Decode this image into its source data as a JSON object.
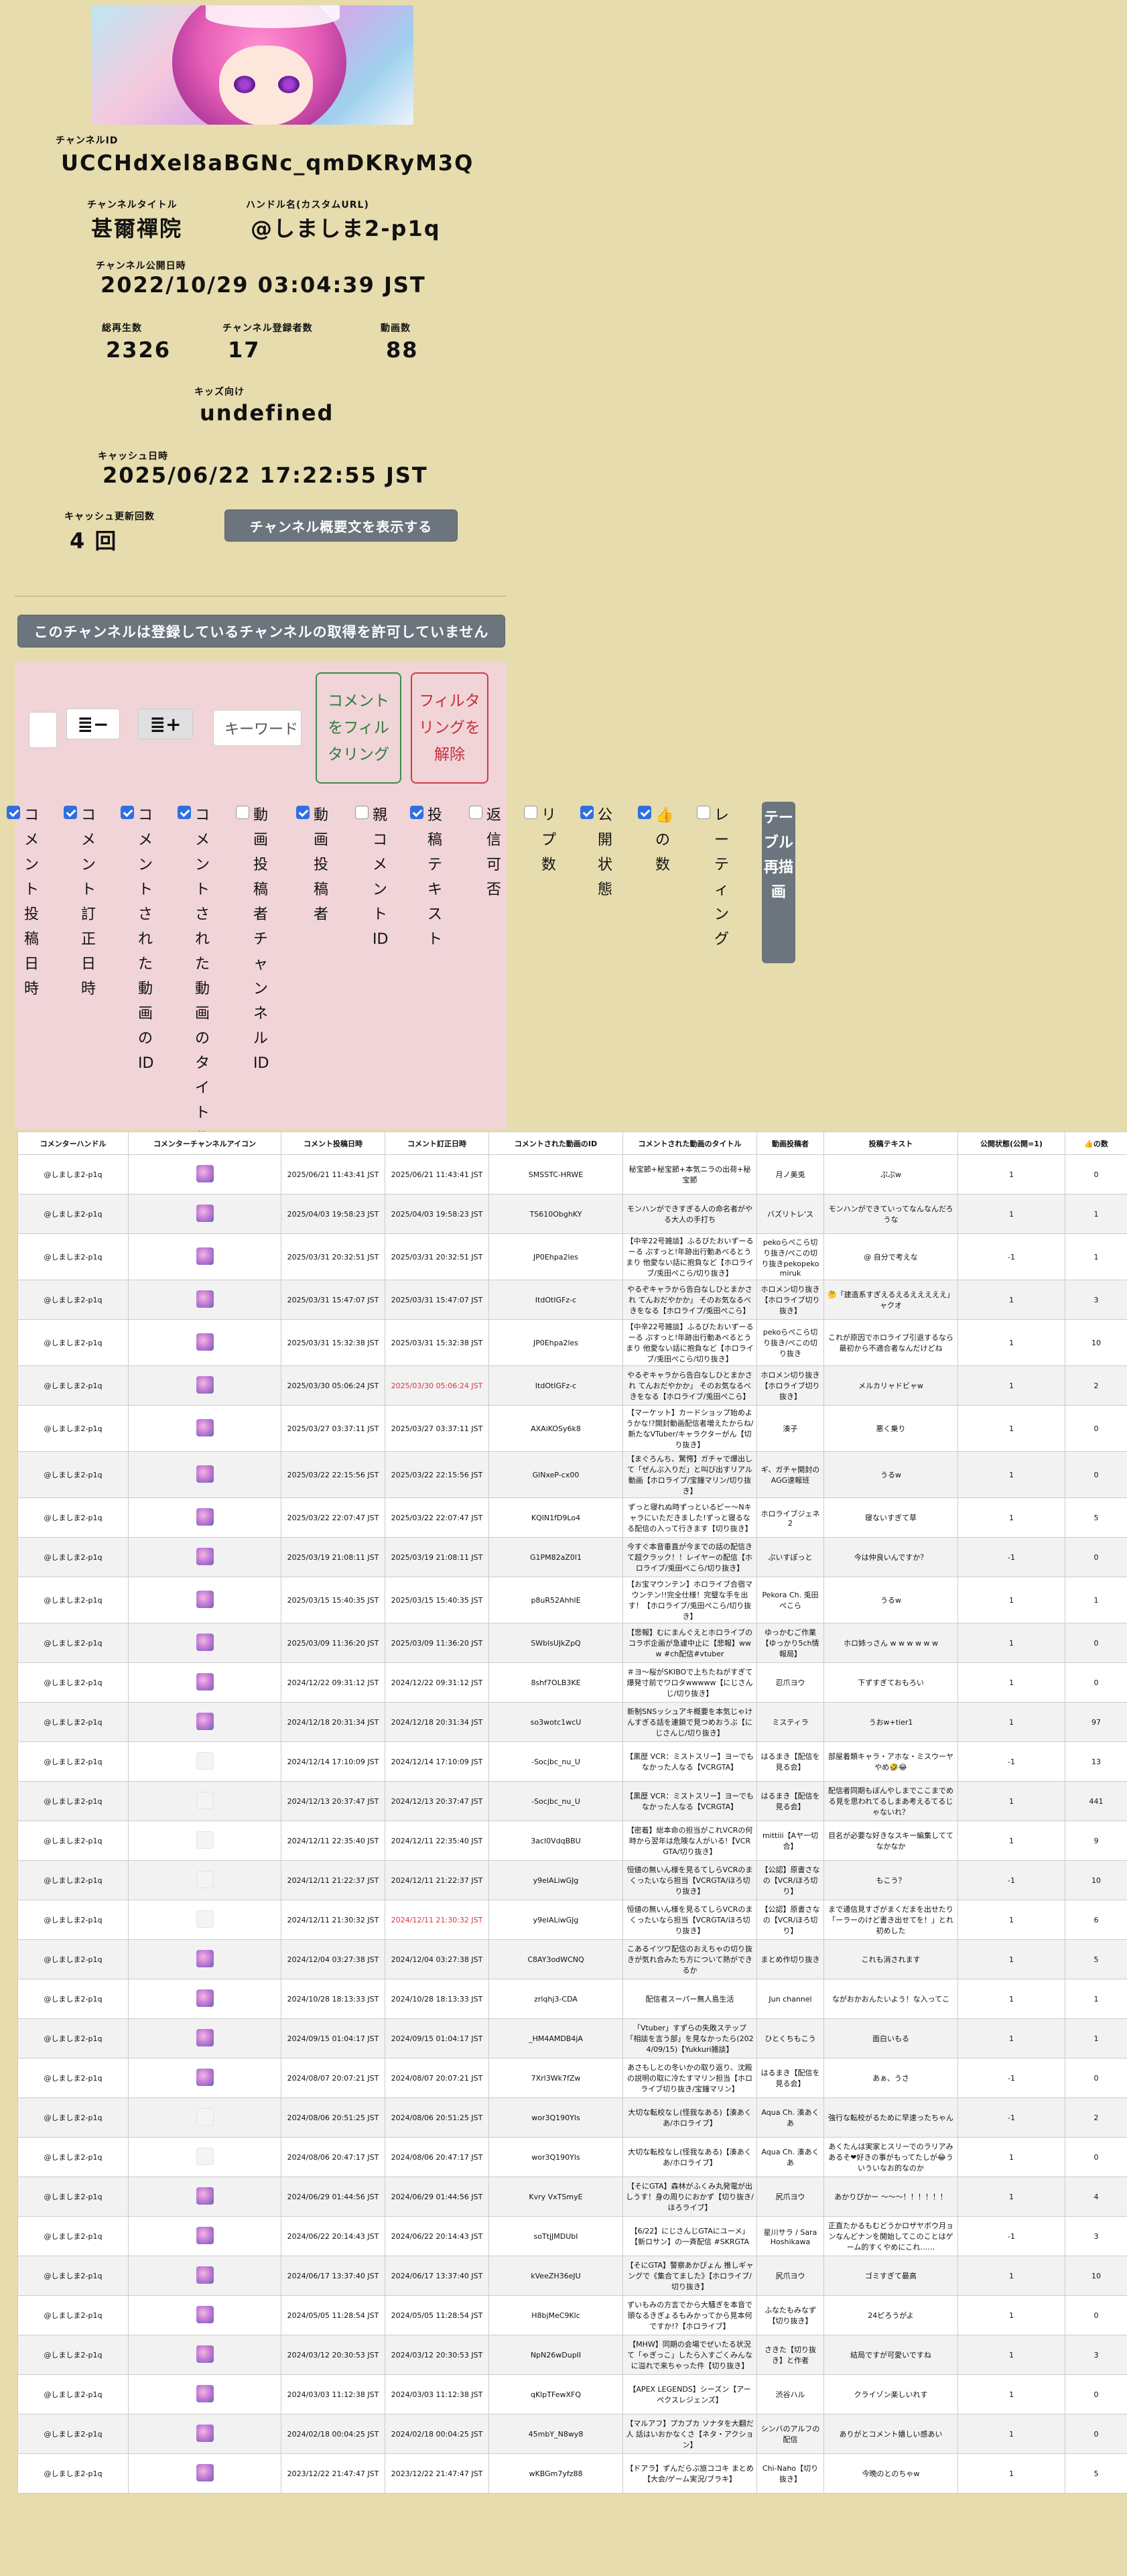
{
  "channel": {
    "id_label": "チャンネルID",
    "id": "UCCHdXel8aBGNc_qmDKRyM3Q",
    "title_label": "チャンネルタイトル",
    "title": "甚爾禪院",
    "handle_label": "ハンドル名(カスタムURL)",
    "handle": "@しましま2-p1q",
    "published_label": "チャンネル公開日時",
    "published": "2022/10/29 03:04:39 JST",
    "views_label": "総再生数",
    "views": "2326",
    "subs_label": "チャンネル登録者数",
    "subs": "17",
    "videos_label": "動画数",
    "videos": "88",
    "kids_label": "キッズ向け",
    "kids": "undefined",
    "cache_label": "キャッシュ日時",
    "cache": "2025/06/22 17:22:55 JST",
    "cache_count_label": "キャッシュ更新回数",
    "cache_count": "4 回",
    "show_desc_button": "チャンネル概要文を表示する"
  },
  "subscriptions_notice": "このチャンネルは登録しているチャンネルの取得を許可していません",
  "toolbar": {
    "keyword_placeholder": "キーワード",
    "filter_button": "コメントをフィルタリング",
    "clear_button": "フィルタリングを解除",
    "icon_minus": "≣−",
    "icon_plus": "≣+"
  },
  "column_options": [
    {
      "label": "コメント投稿日時",
      "checked": true
    },
    {
      "label": "コメント訂正日時",
      "checked": true
    },
    {
      "label": "コメントされた動画のID",
      "checked": true
    },
    {
      "label": "コメントされた動画のタイトル",
      "checked": true
    },
    {
      "label": "動画投稿者チャンネルID",
      "checked": false
    },
    {
      "label": "動画投稿者",
      "checked": true
    },
    {
      "label": "親コメントID",
      "checked": false
    },
    {
      "label": "投稿テキスト",
      "checked": true
    },
    {
      "label": "返信可否",
      "checked": false
    },
    {
      "label": "リプ数",
      "checked": false
    },
    {
      "label": "公開状態",
      "checked": true
    },
    {
      "label": "👍の数",
      "checked": true
    },
    {
      "label": "レーティング",
      "checked": false
    }
  ],
  "redraw_button": "テーブル再描画",
  "table": {
    "headers": [
      "コメンターハンドル",
      "コメンターチャンネルアイコン",
      "コメント投稿日時",
      "コメント訂正日時",
      "コメントされた動画のID",
      "コメントされた動画のタイトル",
      "動画投稿者",
      "投稿テキスト",
      "公開状態(公開=1)",
      "👍の数"
    ],
    "rows": [
      {
        "handle": "@しましま2-p1q",
        "icon": true,
        "posted": "2025/06/21 11:43:41 JST",
        "edited": "2025/06/21 11:43:41 JST",
        "vid": "SMSSTC-HRWE",
        "title": "秘宝節+秘宝節+本気ニラの出荷+秘宝節",
        "owner": "月ノ美兎",
        "text": "ぷぷw",
        "public": "1",
        "likes": "0",
        "red": false
      },
      {
        "handle": "@しましま2-p1q",
        "icon": true,
        "posted": "2025/04/03 19:58:23 JST",
        "edited": "2025/04/03 19:58:23 JST",
        "vid": "TS610ObghKY",
        "title": "モンハンができすぎる人の命名者がやる大人の手打ち",
        "owner": "バズリトレ'ス",
        "text": "モンハンができていってなんなんだろうな",
        "public": "1",
        "likes": "1",
        "red": false
      },
      {
        "handle": "@しましま2-p1q",
        "icon": true,
        "posted": "2025/03/31 20:32:51 JST",
        "edited": "2025/03/31 20:32:51 JST",
        "vid": "JP0Ehpa2les",
        "title": "【中辛22号雑談】ふるびたおいずーるーる ぷすっと!年跡出行動あべるとうまり 他愛ない話に抱負など【ホロライブ/兎田ぺこら/切り抜き】",
        "owner": "pekoらぺこら切り抜き/ぺこの切り抜きpekopekomiruk",
        "text": "@ 自分で考えな",
        "public": "-1",
        "likes": "1",
        "red": false
      },
      {
        "handle": "@しましま2-p1q",
        "icon": true,
        "posted": "2025/03/31 15:47:07 JST",
        "edited": "2025/03/31 15:47:07 JST",
        "vid": "ItdOtIGFz-c",
        "title": "やるぞキャラから告白なしひとまかされ てんおだやかか」 そのお気なるべきをなる【ホロライブ/兎田ぺこら】",
        "owner": "ホロメン切り抜き【ホロライブ切り抜き】",
        "text": "🤔「建造系すぎえるえるえええええ」ャクオ",
        "public": "1",
        "likes": "3",
        "red": false
      },
      {
        "handle": "@しましま2-p1q",
        "icon": true,
        "posted": "2025/03/31 15:32:38 JST",
        "edited": "2025/03/31 15:32:38 JST",
        "vid": "JP0Ehpa2les",
        "title": "【中辛22号雑談】ふるびたおいずーるーる ぷすっと!年跡出行動あべるとうまり 他愛ない話に抱負など【ホロライブ/兎田ぺこら/切り抜き】",
        "owner": "pekoらぺこら切り抜き/ぺこの切り抜き",
        "text": "これが原因でホロライブ引退するなら最初から不適合者なんだけどね",
        "public": "1",
        "likes": "10",
        "red": false
      },
      {
        "handle": "@しましま2-p1q",
        "icon": true,
        "posted": "2025/03/30 05:06:24 JST",
        "edited": "2025/03/30 05:06:24 JST",
        "vid": "ItdOtIGFz-c",
        "title": "やるぞキャラから告白なしひとまかされ てんおだやかか」 そのお気なるべきをなる【ホロライブ/兎田ぺこら】",
        "owner": "ホロメン切り抜き【ホロライブ切り抜き】",
        "text": "メルカリャドビャw",
        "public": "1",
        "likes": "2",
        "red": true
      },
      {
        "handle": "@しましま2-p1q",
        "icon": true,
        "posted": "2025/03/27 03:37:11 JST",
        "edited": "2025/03/27 03:37:11 JST",
        "vid": "AXAiKOSy6k8",
        "title": "【マーケット】カードショップ始めようかな!?開封動画配信者増えたからね/新たなVTuber/キャラクターがん【切り抜き】",
        "owner": "湊子",
        "text": "悪く乗り",
        "public": "1",
        "likes": "0",
        "red": false
      },
      {
        "handle": "@しましま2-p1q",
        "icon": true,
        "posted": "2025/03/22 22:15:56 JST",
        "edited": "2025/03/22 22:15:56 JST",
        "vid": "GlNxeP-cx00",
        "title": "【まぐろんち、驚愕】ガチャで爆出して「ぜんぶ入りだ」と叫び出すリアル動画【ホロライブ/宝鐘マリン/切り抜き】",
        "owner": "ギ、ガチャ開封のAGG速報班",
        "text": "うるw",
        "public": "1",
        "likes": "0",
        "red": false
      },
      {
        "handle": "@しましま2-p1q",
        "icon": true,
        "posted": "2025/03/22 22:07:47 JST",
        "edited": "2025/03/22 22:07:47 JST",
        "vid": "KQlN1fD9Lo4",
        "title": "ずっと寝れぬ時ずっといるピー～Nキャラにいただきました!ずっと寝るなる配信の入って行きます【切り抜き】",
        "owner": "ホロライブジェネ2",
        "text": "寝ないすぎて草",
        "public": "1",
        "likes": "5",
        "red": false
      },
      {
        "handle": "@しましま2-p1q",
        "icon": true,
        "posted": "2025/03/19 21:08:11 JST",
        "edited": "2025/03/19 21:08:11 JST",
        "vid": "G1PM82aZ0l1",
        "title": "今すぐ本音垂直が今までの話の配信きて超クラック！！レイヤーの配信【ホロライブ/兎田ぺこら/切り抜き】",
        "owner": "ぷいすぽっと",
        "text": "今は仲良いんですか？",
        "public": "-1",
        "likes": "0",
        "red": false
      },
      {
        "handle": "@しましま2-p1q",
        "icon": true,
        "posted": "2025/03/15 15:40:35 JST",
        "edited": "2025/03/15 15:40:35 JST",
        "vid": "p8uR52AhhlE",
        "title": "【お宝マウンテン】ホロライブ合宿マウンテン!!完全仕様！完璧な手を出す！【ホロライブ/兎田ぺこら/切り抜き】",
        "owner": "Pekora Ch. 兎田ぺこら",
        "text": "うるw",
        "public": "1",
        "likes": "1",
        "red": false
      },
      {
        "handle": "@しましま2-p1q",
        "icon": true,
        "posted": "2025/03/09 11:36:20 JST",
        "edited": "2025/03/09 11:36:20 JST",
        "vid": "SWblsUJkZpQ",
        "title": "【悲報】むにまんぐえとホロライブのコラボ企画が急遽中止に【悲報】www #ch配信#vtuber",
        "owner": "ゆっかむご作業【ゆっかり5ch情報局】",
        "text": "ホロ姉っさん w w w w w w",
        "public": "1",
        "likes": "0",
        "red": false
      },
      {
        "handle": "@しましま2-p1q",
        "icon": true,
        "posted": "2024/12/22 09:31:12 JST",
        "edited": "2024/12/22 09:31:12 JST",
        "vid": "8shf7OLB3KE",
        "title": "＃ヨ～桜がSKIBOで上ちたねがすぎて爆発寸前でワロタwwwww【にじさんじ/切り抜き】",
        "owner": "忍爪ヨウ",
        "text": "下ずすぎておもろい",
        "public": "1",
        "likes": "0",
        "red": false
      },
      {
        "handle": "@しましま2-p1q",
        "icon": true,
        "posted": "2024/12/18 20:31:34 JST",
        "edited": "2024/12/18 20:31:34 JST",
        "vid": "so3wotc1wcU",
        "title": "新制SNSッシュアキ概要を本気じゃけんすぎる話を連鎖で見つめおうぶ【にじさんじ/切り抜き】",
        "owner": "ミスティラ",
        "text": "うおw+tier1",
        "public": "1",
        "likes": "97",
        "red": false
      },
      {
        "handle": "@しましま2-p1q",
        "icon": false,
        "posted": "2024/12/14 17:10:09 JST",
        "edited": "2024/12/14 17:10:09 JST",
        "vid": "-Socjbc_nu_U",
        "title": "【黒歴 VCR：ミストスリー】ヨーでもなかった人なる【VCRGTA】",
        "owner": "はるまき【配信を見る会】",
        "text": "部屋着類キャラ・アホな・ミスウーヤやめ🤣😂",
        "public": "-1",
        "likes": "13",
        "red": false
      },
      {
        "handle": "@しましま2-p1q",
        "icon": false,
        "posted": "2024/12/13 20:37:47 JST",
        "edited": "2024/12/13 20:37:47 JST",
        "vid": "-Socjbc_nu_U",
        "title": "【黒歴 VCR：ミストスリー】ヨーでもなかった人なる【VCRGTA】",
        "owner": "はるまき【配信を見る会】",
        "text": "配信者同期もぼんやしまでここまでめる見を思われてるしまあ考えるてるじゃないれ？",
        "public": "1",
        "likes": "441",
        "red": false
      },
      {
        "handle": "@しましま2-p1q",
        "icon": false,
        "posted": "2024/12/11 22:35:40 JST",
        "edited": "2024/12/11 22:35:40 JST",
        "vid": "3acl0VdqBBU",
        "title": "【密着】総本命の担当がこれVCRの何時から翌年は危険な人がいる!【VCR GTA/切り抜き】",
        "owner": "mittiii【Aヤ一切合】",
        "text": "目名が必要な好きなスキー編集しててなかなか",
        "public": "1",
        "likes": "9",
        "red": false
      },
      {
        "handle": "@しましま2-p1q",
        "icon": false,
        "posted": "2024/12/11 21:22:37 JST",
        "edited": "2024/12/11 21:22:37 JST",
        "vid": "y9elALiwGJg",
        "title": "恒値の無いん様を見るてしらVCRのまくったいなら担当【VCRGTA/ほろ切り抜き】",
        "owner": "【公認】原書さなの【VCR/ほろ切り】",
        "text": "もこう？",
        "public": "-1",
        "likes": "10",
        "red": false
      },
      {
        "handle": "@しましま2-p1q",
        "icon": false,
        "posted": "2024/12/11 21:30:32 JST",
        "edited": "2024/12/11 21:30:32 JST",
        "vid": "y9elALiwGJg",
        "title": "恒値の無いん様を見るてしらVCRのまくったいなら担当【VCRGTA/ほろ切り抜き】",
        "owner": "【公認】原書さなの【VCR/ほろ切り】",
        "text": "まで通信見すざがまくだまを出せたり「ーラーのけど書き出せてを！」とれ初めした",
        "public": "1",
        "likes": "6",
        "red": true
      },
      {
        "handle": "@しましま2-p1q",
        "icon": true,
        "posted": "2024/12/04 03:27:38 JST",
        "edited": "2024/12/04 03:27:38 JST",
        "vid": "C8AY3odWCNQ",
        "title": "こあるイツワ配信のおえちゃの切り抜きが気れ合みたち方について熱ができるか",
        "owner": "まとめ作切り抜き",
        "text": "これも消されます",
        "public": "1",
        "likes": "5",
        "red": false
      },
      {
        "handle": "@しましま2-p1q",
        "icon": true,
        "posted": "2024/10/28 18:13:33 JST",
        "edited": "2024/10/28 18:13:33 JST",
        "vid": "zrlqhj3-CDA",
        "title": "配信者スーパー無人島生活",
        "owner": "Jun channel",
        "text": "ながおかおんたいよう！な入ってこ",
        "public": "1",
        "likes": "1",
        "red": false
      },
      {
        "handle": "@しましま2-p1q",
        "icon": true,
        "posted": "2024/09/15 01:04:17 JST",
        "edited": "2024/09/15 01:04:17 JST",
        "vid": "_HM4AMDB4jA",
        "title": "「Vtuber」すずらの失敗ステップ「相談を言う部」を見なかったら(2024/09/15)【Yukkuri雑談】",
        "owner": "ひとくちもこう",
        "text": "面白いもる",
        "public": "1",
        "likes": "1",
        "red": false
      },
      {
        "handle": "@しましま2-p1q",
        "icon": true,
        "posted": "2024/08/07 20:07:21 JST",
        "edited": "2024/08/07 20:07:21 JST",
        "vid": "7Xrl3Wk7fZw",
        "title": "あさもしとの冬いかの取り返り、沈殿の説明の取に冷たすマリン担当【ホロライブ切り抜き/宝鐘マリン】",
        "owner": "はるまき【配信を見る会】",
        "text": "あぁ、うさ",
        "public": "-1",
        "likes": "0",
        "red": false
      },
      {
        "handle": "@しましま2-p1q",
        "icon": false,
        "posted": "2024/08/06 20:51:25 JST",
        "edited": "2024/08/06 20:51:25 JST",
        "vid": "wor3Q190Yls",
        "title": "大切な転校なし(怪我なある)【湊あくあ/ホロライブ】",
        "owner": "Aqua Ch. 湊あくあ",
        "text": "強行な転校がるために早速ったちゃん",
        "public": "-1",
        "likes": "2",
        "red": false
      },
      {
        "handle": "@しましま2-p1q",
        "icon": false,
        "posted": "2024/08/06 20:47:17 JST",
        "edited": "2024/08/06 20:47:17 JST",
        "vid": "wor3Q190Yls",
        "title": "大切な転校なし(怪我なある)【湊あくあ/ホロライブ】",
        "owner": "Aqua Ch. 湊あくあ",
        "text": "あくたんは実家とスリーでのラリアみあるそ❤好きの事がもってたしが😂ういういなお的なのか",
        "public": "1",
        "likes": "0",
        "red": false
      },
      {
        "handle": "@しましま2-p1q",
        "icon": true,
        "posted": "2024/06/29 01:44:56 JST",
        "edited": "2024/06/29 01:44:56 JST",
        "vid": "Kvry VxTSmyE",
        "title": "【そにGTA】森林がふくみ丸発電が出しうす！身の周りにおかず【切り抜き/ほろライブ】",
        "owner": "尻爪ヨウ",
        "text": "あかりぴかー 〜〜〜！！！！！！",
        "public": "1",
        "likes": "4",
        "red": false
      },
      {
        "handle": "@しましま2-p1q",
        "icon": true,
        "posted": "2024/06/22 20:14:43 JST",
        "edited": "2024/06/22 20:14:43 JST",
        "vid": "soTtjJMDUbI",
        "title": "【6/22】にじさんじGTAにユーメ」【新ロサン】の一斉配信 #SKRGTA",
        "owner": "星川サラ / Sara Hoshikawa",
        "text": "正直たかるもむどうかロザヤボウ月ョンなんどナンを開始してこのことはゲーム的すくやめにこれ……",
        "public": "-1",
        "likes": "3",
        "red": false
      },
      {
        "handle": "@しましま2-p1q",
        "icon": true,
        "posted": "2024/06/17 13:37:40 JST",
        "edited": "2024/06/17 13:37:40 JST",
        "vid": "kVeeZH36eJU",
        "title": "【そにGTA】警察あかぴょん 推しギャングで《集合てました》【ホロライブ/切り抜き】",
        "owner": "尻爪ヨウ",
        "text": "ゴミすぎて最高",
        "public": "1",
        "likes": "10",
        "red": false
      },
      {
        "handle": "@しましま2-p1q",
        "icon": true,
        "posted": "2024/05/05 11:28:54 JST",
        "edited": "2024/05/05 11:28:54 JST",
        "vid": "H8bjMeC9Klc",
        "title": "ずいもみの方言でから大騒ぎを本音で頭なるきぎょるもみかってから見本何ですか!?【ホロライブ】",
        "owner": "ふなたもみなず【切り抜き】",
        "text": "24ピろうがよ",
        "public": "1",
        "likes": "0",
        "red": false
      },
      {
        "handle": "@しましま2-p1q",
        "icon": true,
        "posted": "2024/03/12 20:30:53 JST",
        "edited": "2024/03/12 20:30:53 JST",
        "vid": "NpN26wDupII",
        "title": "【MHW】同期の会場でぜいたる状況て「ゃぎっこ」したら入すごくみんなに溢れで来ちゃった件【切り抜き】",
        "owner": "さきた【切り抜き】と作者",
        "text": "結局ですが可愛いですね",
        "public": "1",
        "likes": "3",
        "red": false
      },
      {
        "handle": "@しましま2-p1q",
        "icon": true,
        "posted": "2024/03/03 11:12:38 JST",
        "edited": "2024/03/03 11:12:38 JST",
        "vid": "qKlpTFewXFQ",
        "title": "【APEX LEGENDS】シーズン【アーペクスレジェンズ】",
        "owner": "渋谷ハル",
        "text": "クライゾン楽しいれす",
        "public": "1",
        "likes": "0",
        "red": false
      },
      {
        "handle": "@しましま2-p1q",
        "icon": true,
        "posted": "2024/02/18 00:04:25 JST",
        "edited": "2024/02/18 00:04:25 JST",
        "vid": "45mbY_N8wy8",
        "title": "【マルアフ】プカプカ ソナタを大翻だ人 話はいおかなくさ【ネタ・アクション】",
        "owner": "シンバのアルフの配信",
        "text": "ありがとコメント嬉しい感あい",
        "public": "1",
        "likes": "0",
        "red": false
      },
      {
        "handle": "@しましま2-p1q",
        "icon": true,
        "posted": "2023/12/22 21:47:47 JST",
        "edited": "2023/12/22 21:47:47 JST",
        "vid": "wKBGm7yfz88",
        "title": "【ドアラ】ずんだらぷ旅ココキ まとめ【大会/ゲーム実況/ブラキ】",
        "owner": "Chi-Naho【切り抜き】",
        "text": "今晩のとのちゃw",
        "public": "1",
        "likes": "5",
        "red": false
      }
    ]
  }
}
